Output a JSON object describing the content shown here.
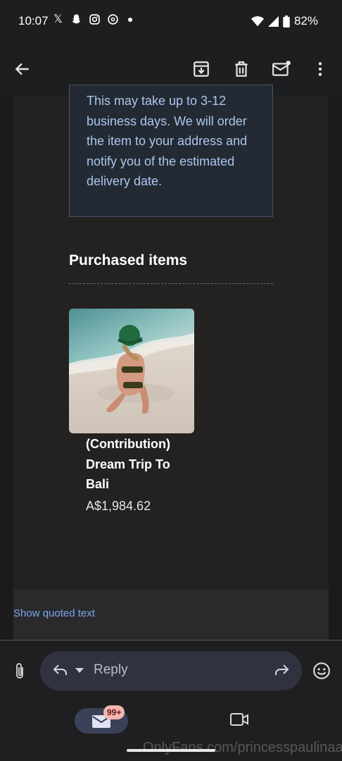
{
  "status_bar": {
    "time": "10:07",
    "battery": "82%",
    "app_icons": [
      "x-icon",
      "snapchat-icon",
      "instagram-icon",
      "threads-icon"
    ]
  },
  "app_bar": {
    "icons": [
      "back-arrow-icon",
      "archive-icon",
      "delete-icon",
      "mark-unread-icon",
      "more-vert-icon"
    ]
  },
  "message": {
    "info_text": "This may take up to 3-12 business days. We will order the item to your address and notify you of the estimated delivery date.",
    "purchased_heading": "Purchased items",
    "item": {
      "name": "(Contribution) Dream Trip To Bali",
      "price": "A$1,984.62"
    },
    "show_quoted": "Show quoted text"
  },
  "reply_bar": {
    "placeholder": "Reply"
  },
  "bottom_nav": {
    "mail_badge": "99+"
  },
  "watermark": "OnlyFans.com/princesspaulinaa",
  "colors": {
    "accent_link": "#7aa6ea",
    "info_text": "#a9c6ee",
    "badge": "#f4b6b1"
  }
}
